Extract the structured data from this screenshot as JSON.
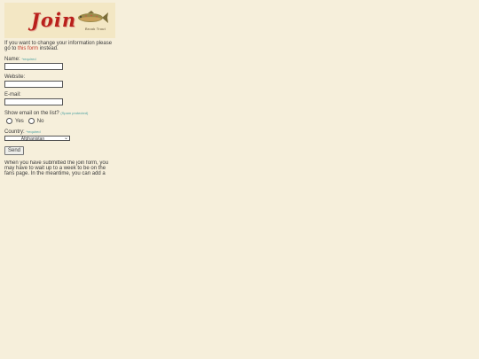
{
  "banner": {
    "title": "Join",
    "caption": "Brook Trout",
    "logo_icon": "fish-icon"
  },
  "intro": {
    "text_before": "If you want to change your information please go to ",
    "link": "this form",
    "text_after": " instead."
  },
  "form": {
    "name": {
      "label": "Name:",
      "required": "*required",
      "value": ""
    },
    "website": {
      "label": "Website:",
      "value": ""
    },
    "email": {
      "label": "E-mail:",
      "value": ""
    },
    "show_email": {
      "label": "Show email on the list?",
      "note": "(Spam protected)",
      "options": [
        "Yes",
        "No"
      ]
    },
    "country": {
      "label": "Country:",
      "required": "*required",
      "selected": "Afghanistan"
    },
    "submit_label": "Send"
  },
  "note": "When you have submitted the join form, you may have to wait up to a week to be on the fans page. In the meantime, you can add a button to your site. This form has been made using"
}
